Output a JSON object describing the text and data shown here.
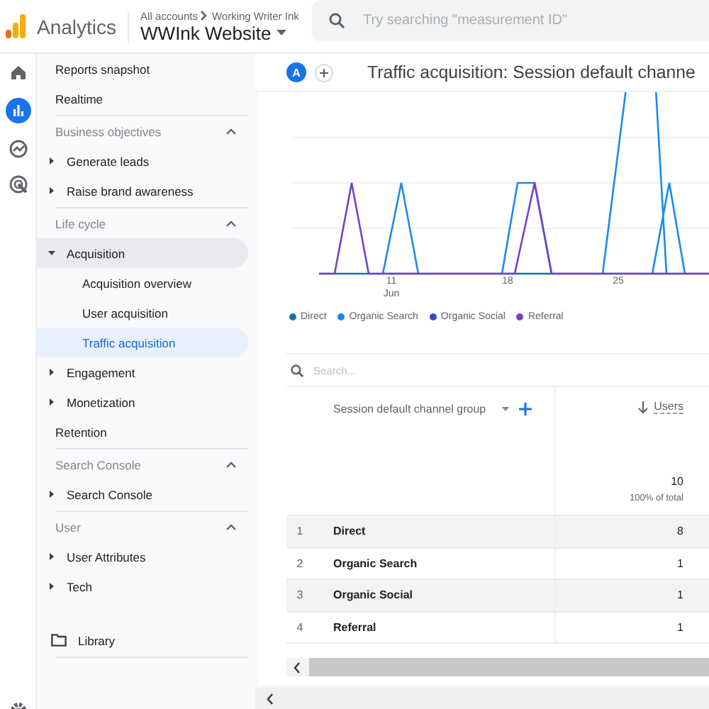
{
  "header": {
    "product": "Analytics",
    "breadcrumb": [
      "All accounts",
      "Working Writer Ink"
    ],
    "property": "WWInk Website",
    "search": {
      "placeholder": "Try searching \"measurement ID\""
    }
  },
  "rail": [
    {
      "kind": "home",
      "selected": false
    },
    {
      "kind": "reports",
      "selected": true
    },
    {
      "kind": "explore",
      "selected": false
    },
    {
      "kind": "advertising",
      "selected": false
    },
    {
      "kind": "settings",
      "selected": false
    }
  ],
  "nav": {
    "items": [
      {
        "label": "Reports snapshot",
        "kind": "link",
        "selected": false
      },
      {
        "label": "Realtime",
        "kind": "link",
        "selected": false
      }
    ],
    "sections": [
      {
        "title": "Business objectives",
        "expanded": true,
        "items": [
          {
            "label": "Generate leads",
            "kind": "group",
            "expanded": false
          },
          {
            "label": "Raise brand awareness",
            "kind": "group",
            "expanded": false
          }
        ]
      },
      {
        "title": "Life cycle",
        "expanded": true,
        "items": [
          {
            "label": "Acquisition",
            "kind": "group",
            "expanded": true,
            "children": [
              {
                "label": "Acquisition overview",
                "selected": false
              },
              {
                "label": "User acquisition",
                "selected": false
              },
              {
                "label": "Traffic acquisition",
                "selected": true
              }
            ]
          },
          {
            "label": "Engagement",
            "kind": "group",
            "expanded": false
          },
          {
            "label": "Monetization",
            "kind": "group",
            "expanded": false
          },
          {
            "label": "Retention",
            "kind": "link",
            "selected": false
          }
        ]
      },
      {
        "title": "Search Console",
        "expanded": true,
        "items": [
          {
            "label": "Search Console",
            "kind": "group",
            "expanded": false
          }
        ]
      },
      {
        "title": "User",
        "expanded": true,
        "items": [
          {
            "label": "User Attributes",
            "kind": "group",
            "expanded": false
          },
          {
            "label": "Tech",
            "kind": "group",
            "expanded": false
          }
        ]
      }
    ],
    "footer": {
      "label": "Library"
    }
  },
  "report": {
    "avatar": "A",
    "title": "Traffic acquisition: Session default channe",
    "chart": {
      "x_labels": [
        {
          "day": "11",
          "month": "Jun"
        },
        {
          "day": "18"
        },
        {
          "day": "25"
        }
      ],
      "legend": [
        {
          "name": "Direct",
          "color": "#13759f"
        },
        {
          "name": "Organic Search",
          "color": "#1d8ae6"
        },
        {
          "name": "Organic Social",
          "color": "#3644d6"
        },
        {
          "name": "Referral",
          "color": "#7443c4"
        }
      ]
    },
    "table": {
      "search": {
        "placeholder": "Search..."
      },
      "columns": [
        {
          "label": "Session default channel group"
        },
        {
          "label": "Users",
          "sorted": true
        }
      ],
      "totals": {
        "value": "10",
        "note": "100% of total"
      },
      "rows": [
        {
          "rank": "1",
          "channel": "Direct",
          "users": "8"
        },
        {
          "rank": "2",
          "channel": "Organic Search",
          "users": "1"
        },
        {
          "rank": "3",
          "channel": "Organic Social",
          "users": "1"
        },
        {
          "rank": "4",
          "channel": "Referral",
          "users": "1"
        }
      ]
    }
  }
}
